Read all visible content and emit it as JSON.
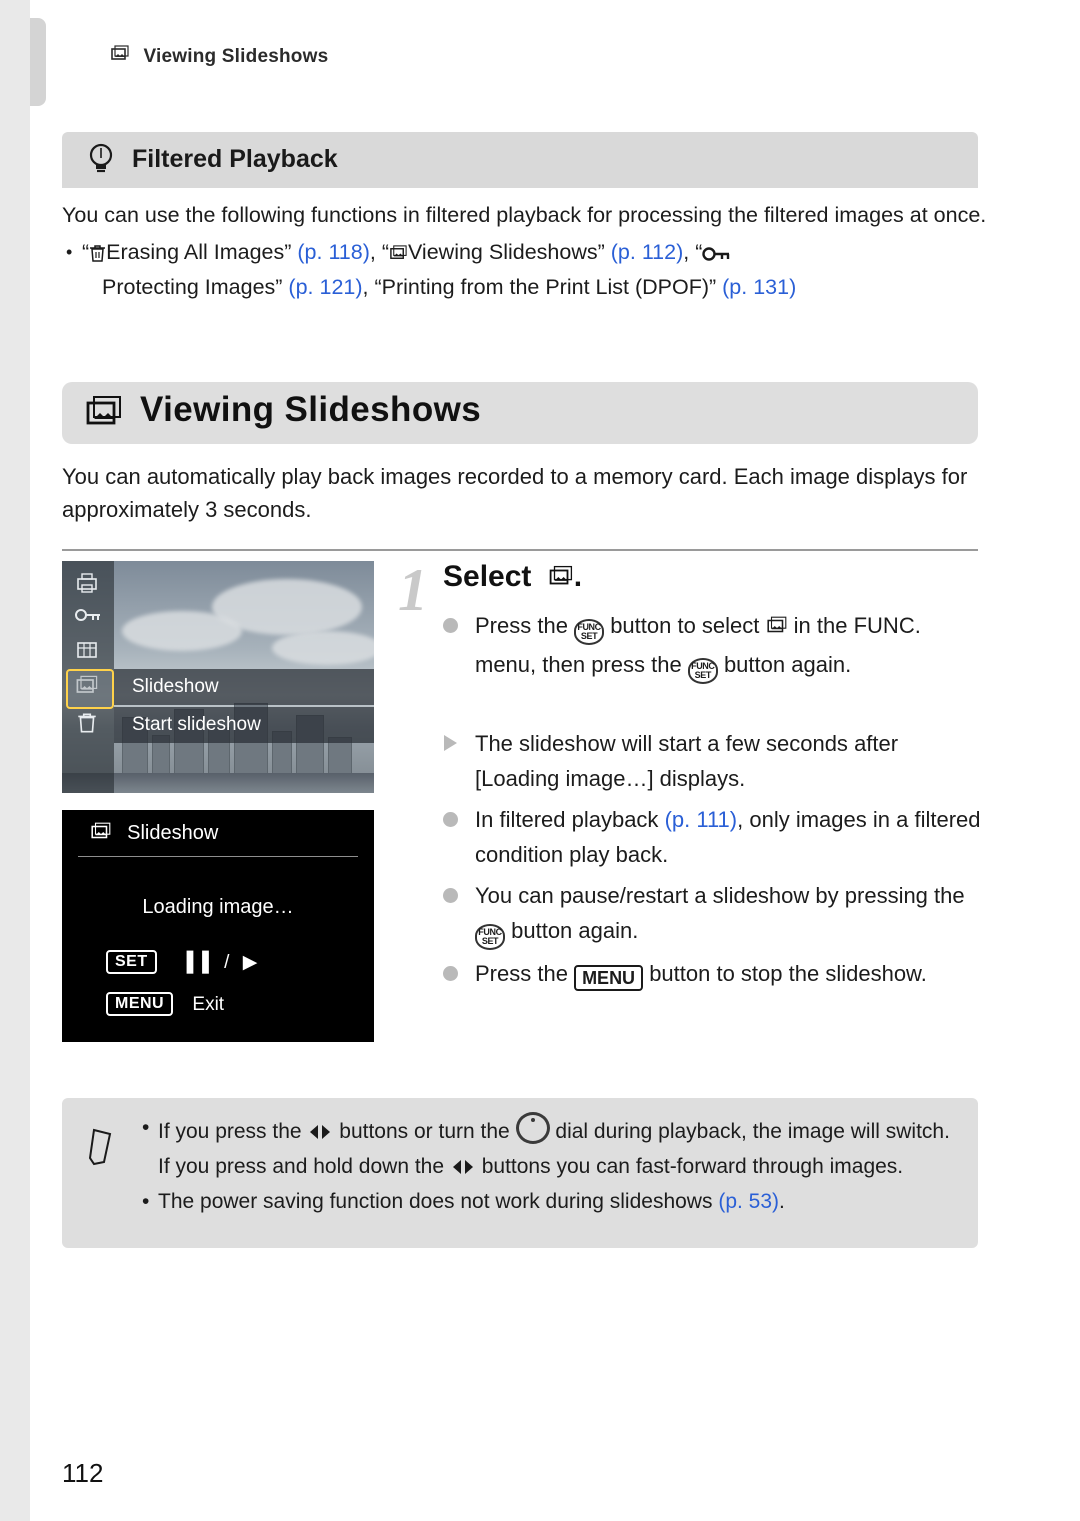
{
  "running_head": {
    "label": "Viewing Slideshows",
    "icon": "slideshow-icon"
  },
  "tip": {
    "title": "Filtered Playback",
    "icon": "lightbulb-icon",
    "paragraph": "You can use the following functions in filtered playback for processing the filtered images at once.",
    "list_line1_pre": "“",
    "list_line1_a": "Erasing All Images” ",
    "list_line1_page_a": "(p. 118)",
    "list_line1_sep1": ",  “",
    "list_line1_b": "Viewing Slideshows” ",
    "list_line1_page_b": "(p. 112)",
    "list_line1_sep2": ",  “",
    "list_line2_a": "Protecting Images” ",
    "list_line2_page_a": "(p. 121)",
    "list_line2_sep": ",  “Printing from the Print List (DPOF)” ",
    "list_line2_page_b": "(p. 131)"
  },
  "section": {
    "title": "Viewing Slideshows",
    "icon": "slideshow-icon",
    "lede": "You can automatically play back images recorded to a memory card. Each image displays for approximately 3 seconds."
  },
  "figure1": {
    "menu_label": "Slideshow",
    "option_label": "Start slideshow",
    "side_icons": [
      "print-icon",
      "protect-icon",
      "rotate-icon",
      "slideshow-icon",
      "erase-icon"
    ]
  },
  "figure2": {
    "title": "Slideshow",
    "title_icon": "slideshow-icon",
    "loading": "Loading image…",
    "row1_key": "SET",
    "row1_text": "/",
    "row2_key": "MENU",
    "row2_text": "Exit"
  },
  "step": {
    "number": "1",
    "title_pre": "Select",
    "title_icon": "slideshow-icon",
    "title_post": ".",
    "b1_pre": "Press the",
    "b1_mid": "button to select",
    "b1_post": "in the",
    "b1_line2_pre": "FUNC. menu, then press the",
    "b1_line2_post": "button",
    "b1_line3": "again.",
    "b2_line1": "The slideshow will start a few seconds",
    "b2_line2": "after [Loading image…] displays.",
    "b3_pre": "In filtered playback",
    "b3_page": "(p. 111)",
    "b3_post": ", only images",
    "b3_line2": "in a filtered condition play back.",
    "b4_line1": "You can pause/restart a slideshow by",
    "b4_line2_pre": "pressing the",
    "b4_line2_post": "button again.",
    "b5_pre": "Press the",
    "b5_key": "MENU",
    "b5_post": "button to stop the",
    "b5_line2": "slideshow."
  },
  "note": {
    "icon": "pencil-note-icon",
    "l1_pre": "If you press the",
    "l1_mid": "buttons or turn the",
    "l1_post": "dial during playback, the",
    "l2_pre": "image will switch. If you press and hold down the",
    "l2_post": "buttons you can",
    "l3": "fast-forward through images.",
    "l4_pre": "The power saving function does not work during slideshows",
    "l4_page": "(p. 53)",
    "l4_post": "."
  },
  "page_number": "112",
  "colors": {
    "link": "#2a5fd6",
    "panel": "#dedede",
    "tipbar": "#d9d9d9"
  }
}
